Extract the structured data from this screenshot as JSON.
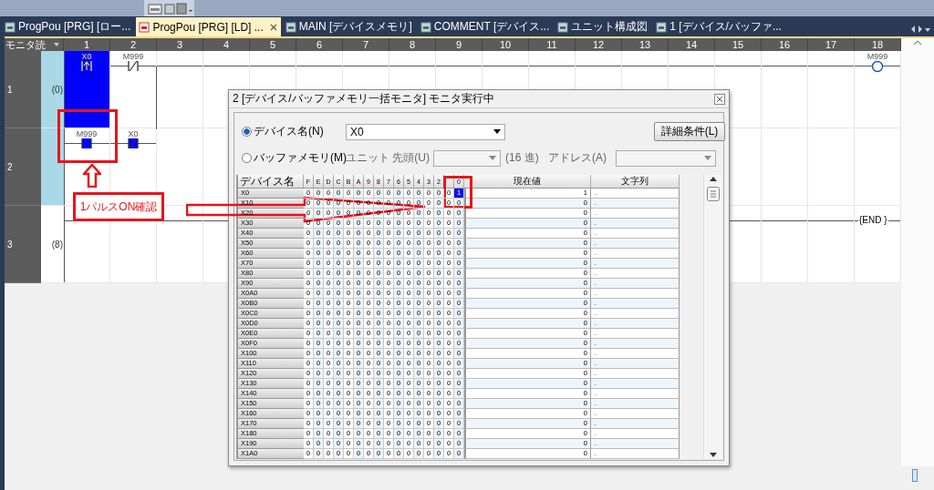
{
  "tabs": [
    {
      "label": "ProgPou [PRG] [ロー...",
      "selected": false
    },
    {
      "label": "ProgPou [PRG] [LD] ...",
      "selected": true
    },
    {
      "label": "MAIN [デバイスメモリ]",
      "selected": false
    },
    {
      "label": "COMMENT [デバイス...",
      "selected": false
    },
    {
      "label": "ユニット構成図",
      "selected": false
    },
    {
      "label": "1 [デバイス/バッファ...",
      "selected": false
    }
  ],
  "ladder": {
    "corner_label": "モニタ読",
    "columns": [
      "1",
      "2",
      "3",
      "4",
      "5",
      "6",
      "7",
      "8",
      "9",
      "10",
      "11",
      "12",
      "13",
      "14",
      "15",
      "16",
      "17",
      "18"
    ],
    "rows": [
      {
        "number": "1",
        "step": "(0)",
        "selected": true,
        "elements": [
          {
            "kind": "pulse_contact",
            "device": "X0",
            "on": true,
            "selected": true
          },
          {
            "kind": "nc_contact",
            "device": "M999",
            "on": false,
            "selected": false
          },
          {
            "kind": "coil",
            "device": "M999",
            "on": false,
            "selected": false
          }
        ]
      },
      {
        "number": "2",
        "selected": true,
        "elements": [
          {
            "kind": "no_contact",
            "device": "M999",
            "on": true,
            "selected": false
          },
          {
            "kind": "nc_contact",
            "device": "X0",
            "on": true,
            "selected": false
          }
        ]
      },
      {
        "number": "3",
        "step": "(8)",
        "selected": false,
        "elements": [
          {
            "kind": "end",
            "text": "{END }",
            "selected": false
          }
        ]
      }
    ]
  },
  "monitor_dialog": {
    "title": "2 [デバイス/バッファメモリ一括モニタ] モニタ実行中",
    "device_radio": {
      "label": "デバイス名(N)",
      "selected": true
    },
    "device_value": "X0",
    "detail_button": "詳細条件(L)",
    "buffer_radio": {
      "label": "バッファメモリ(M)",
      "selected": false
    },
    "unit_label": "ユニット 先頭(U)",
    "hex_label": "(16 進)",
    "address_label": "アドレス(A)",
    "table": {
      "name_header": "デバイス名",
      "bit_headers": [
        "F",
        "E",
        "D",
        "C",
        "B",
        "A",
        "9",
        "8",
        "7",
        "6",
        "5",
        "4",
        "3",
        "2",
        "0"
      ],
      "value_header": "現在値",
      "string_header": "文字列",
      "rows": [
        {
          "name": "X0",
          "bits": [
            "0",
            "0",
            "0",
            "0",
            "0",
            "0",
            "0",
            "0",
            "0",
            "0",
            "0",
            "0",
            "0",
            "0",
            "0",
            "1"
          ],
          "value": "1",
          "string": ".."
        },
        {
          "name": "X10",
          "bits": [
            "0",
            "0",
            "0",
            "0",
            "0",
            "0",
            "0",
            "0",
            "0",
            "0",
            "0",
            "0",
            "0",
            "0",
            "0",
            "0"
          ],
          "value": "0",
          "string": ".."
        },
        {
          "name": "X20",
          "bits": [
            "0",
            "0",
            "0",
            "0",
            "0",
            "0",
            "0",
            "0",
            "0",
            "0",
            "0",
            "0",
            "0",
            "0",
            "0",
            "0"
          ],
          "value": "0",
          "string": ".."
        },
        {
          "name": "X30",
          "bits": [
            "0",
            "0",
            "0",
            "0",
            "0",
            "0",
            "0",
            "0",
            "0",
            "0",
            "0",
            "0",
            "0",
            "0",
            "0",
            "0"
          ],
          "value": "0",
          "string": ".."
        },
        {
          "name": "X40",
          "bits": [
            "0",
            "0",
            "0",
            "0",
            "0",
            "0",
            "0",
            "0",
            "0",
            "0",
            "0",
            "0",
            "0",
            "0",
            "0",
            "0"
          ],
          "value": "0",
          "string": ".."
        },
        {
          "name": "X50",
          "bits": [
            "0",
            "0",
            "0",
            "0",
            "0",
            "0",
            "0",
            "0",
            "0",
            "0",
            "0",
            "0",
            "0",
            "0",
            "0",
            "0"
          ],
          "value": "0",
          "string": ".."
        },
        {
          "name": "X60",
          "bits": [
            "0",
            "0",
            "0",
            "0",
            "0",
            "0",
            "0",
            "0",
            "0",
            "0",
            "0",
            "0",
            "0",
            "0",
            "0",
            "0"
          ],
          "value": "0",
          "string": ".."
        },
        {
          "name": "X70",
          "bits": [
            "0",
            "0",
            "0",
            "0",
            "0",
            "0",
            "0",
            "0",
            "0",
            "0",
            "0",
            "0",
            "0",
            "0",
            "0",
            "0"
          ],
          "value": "0",
          "string": ".."
        },
        {
          "name": "X80",
          "bits": [
            "0",
            "0",
            "0",
            "0",
            "0",
            "0",
            "0",
            "0",
            "0",
            "0",
            "0",
            "0",
            "0",
            "0",
            "0",
            "0"
          ],
          "value": "0",
          "string": ".."
        },
        {
          "name": "X90",
          "bits": [
            "0",
            "0",
            "0",
            "0",
            "0",
            "0",
            "0",
            "0",
            "0",
            "0",
            "0",
            "0",
            "0",
            "0",
            "0",
            "0"
          ],
          "value": "0",
          "string": ".."
        },
        {
          "name": "X0A0",
          "bits": [
            "0",
            "0",
            "0",
            "0",
            "0",
            "0",
            "0",
            "0",
            "0",
            "0",
            "0",
            "0",
            "0",
            "0",
            "0",
            "0"
          ],
          "value": "0",
          "string": ".."
        },
        {
          "name": "X0B0",
          "bits": [
            "0",
            "0",
            "0",
            "0",
            "0",
            "0",
            "0",
            "0",
            "0",
            "0",
            "0",
            "0",
            "0",
            "0",
            "0",
            "0"
          ],
          "value": "0",
          "string": ".."
        },
        {
          "name": "X0C0",
          "bits": [
            "0",
            "0",
            "0",
            "0",
            "0",
            "0",
            "0",
            "0",
            "0",
            "0",
            "0",
            "0",
            "0",
            "0",
            "0",
            "0"
          ],
          "value": "0",
          "string": ".."
        },
        {
          "name": "X0D0",
          "bits": [
            "0",
            "0",
            "0",
            "0",
            "0",
            "0",
            "0",
            "0",
            "0",
            "0",
            "0",
            "0",
            "0",
            "0",
            "0",
            "0"
          ],
          "value": "0",
          "string": ".."
        },
        {
          "name": "X0E0",
          "bits": [
            "0",
            "0",
            "0",
            "0",
            "0",
            "0",
            "0",
            "0",
            "0",
            "0",
            "0",
            "0",
            "0",
            "0",
            "0",
            "0"
          ],
          "value": "0",
          "string": ".."
        },
        {
          "name": "X0F0",
          "bits": [
            "0",
            "0",
            "0",
            "0",
            "0",
            "0",
            "0",
            "0",
            "0",
            "0",
            "0",
            "0",
            "0",
            "0",
            "0",
            "0"
          ],
          "value": "0",
          "string": ".."
        },
        {
          "name": "X100",
          "bits": [
            "0",
            "0",
            "0",
            "0",
            "0",
            "0",
            "0",
            "0",
            "0",
            "0",
            "0",
            "0",
            "0",
            "0",
            "0",
            "0"
          ],
          "value": "0",
          "string": ".."
        },
        {
          "name": "X110",
          "bits": [
            "0",
            "0",
            "0",
            "0",
            "0",
            "0",
            "0",
            "0",
            "0",
            "0",
            "0",
            "0",
            "0",
            "0",
            "0",
            "0"
          ],
          "value": "0",
          "string": ".."
        },
        {
          "name": "X120",
          "bits": [
            "0",
            "0",
            "0",
            "0",
            "0",
            "0",
            "0",
            "0",
            "0",
            "0",
            "0",
            "0",
            "0",
            "0",
            "0",
            "0"
          ],
          "value": "0",
          "string": ".."
        },
        {
          "name": "X130",
          "bits": [
            "0",
            "0",
            "0",
            "0",
            "0",
            "0",
            "0",
            "0",
            "0",
            "0",
            "0",
            "0",
            "0",
            "0",
            "0",
            "0"
          ],
          "value": "0",
          "string": ".."
        },
        {
          "name": "X140",
          "bits": [
            "0",
            "0",
            "0",
            "0",
            "0",
            "0",
            "0",
            "0",
            "0",
            "0",
            "0",
            "0",
            "0",
            "0",
            "0",
            "0"
          ],
          "value": "0",
          "string": ".."
        },
        {
          "name": "X150",
          "bits": [
            "0",
            "0",
            "0",
            "0",
            "0",
            "0",
            "0",
            "0",
            "0",
            "0",
            "0",
            "0",
            "0",
            "0",
            "0",
            "0"
          ],
          "value": "0",
          "string": ".."
        },
        {
          "name": "X160",
          "bits": [
            "0",
            "0",
            "0",
            "0",
            "0",
            "0",
            "0",
            "0",
            "0",
            "0",
            "0",
            "0",
            "0",
            "0",
            "0",
            "0"
          ],
          "value": "0",
          "string": ".."
        },
        {
          "name": "X170",
          "bits": [
            "0",
            "0",
            "0",
            "0",
            "0",
            "0",
            "0",
            "0",
            "0",
            "0",
            "0",
            "0",
            "0",
            "0",
            "0",
            "0"
          ],
          "value": "0",
          "string": ".."
        },
        {
          "name": "X180",
          "bits": [
            "0",
            "0",
            "0",
            "0",
            "0",
            "0",
            "0",
            "0",
            "0",
            "0",
            "0",
            "0",
            "0",
            "0",
            "0",
            "0"
          ],
          "value": "0",
          "string": ".."
        },
        {
          "name": "X190",
          "bits": [
            "0",
            "0",
            "0",
            "0",
            "0",
            "0",
            "0",
            "0",
            "0",
            "0",
            "0",
            "0",
            "0",
            "0",
            "0",
            "0"
          ],
          "value": "0",
          "string": ".."
        },
        {
          "name": "X1A0",
          "bits": [
            "0",
            "0",
            "0",
            "0",
            "0",
            "0",
            "0",
            "0",
            "0",
            "0",
            "0",
            "0",
            "0",
            "0",
            "0",
            "0"
          ],
          "value": "0",
          "string": ".."
        }
      ]
    }
  },
  "annotations": [
    {
      "kind": "frame"
    },
    {
      "kind": "up_arrow"
    },
    {
      "kind": "callout",
      "text": "1パルスON確認"
    },
    {
      "kind": "right_arrow"
    },
    {
      "kind": "frame"
    }
  ]
}
